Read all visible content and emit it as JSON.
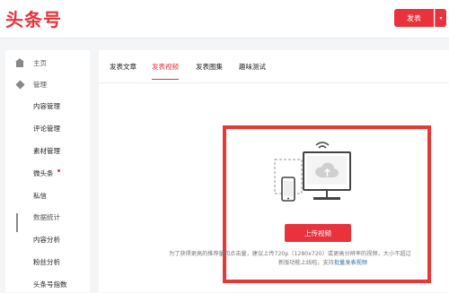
{
  "header": {
    "logo": "头条号",
    "publish_label": "发表",
    "publish_arrow": "▾"
  },
  "sidebar": {
    "items": [
      {
        "label": "主页",
        "icon": "home-icon"
      },
      {
        "label": "管理",
        "icon": "cube-icon"
      },
      {
        "label": "内容管理"
      },
      {
        "label": "评论管理"
      },
      {
        "label": "素材管理"
      },
      {
        "label": "微头条"
      },
      {
        "label": "私信"
      },
      {
        "label": "数据统计",
        "icon": "bar-chart-icon"
      },
      {
        "label": "内容分析"
      },
      {
        "label": "粉丝分析"
      },
      {
        "label": "头条号指数"
      }
    ]
  },
  "tabs": [
    {
      "label": "发表文章"
    },
    {
      "label": "发表视频"
    },
    {
      "label": "发表图集"
    },
    {
      "label": "趣味测试"
    }
  ],
  "upload": {
    "button_label": "上传视频",
    "hint_line1": "为了获得更高的推荐量和点击量，建议上传720p（1280x720）或更高分辨率的视频，大小不超过",
    "hint_line2_pre": "新版功能上线啦，支持",
    "hint_line2_link": "批量发表视频"
  },
  "colors": {
    "brand": "#e8323c",
    "highlight_frame": "#e53935"
  }
}
